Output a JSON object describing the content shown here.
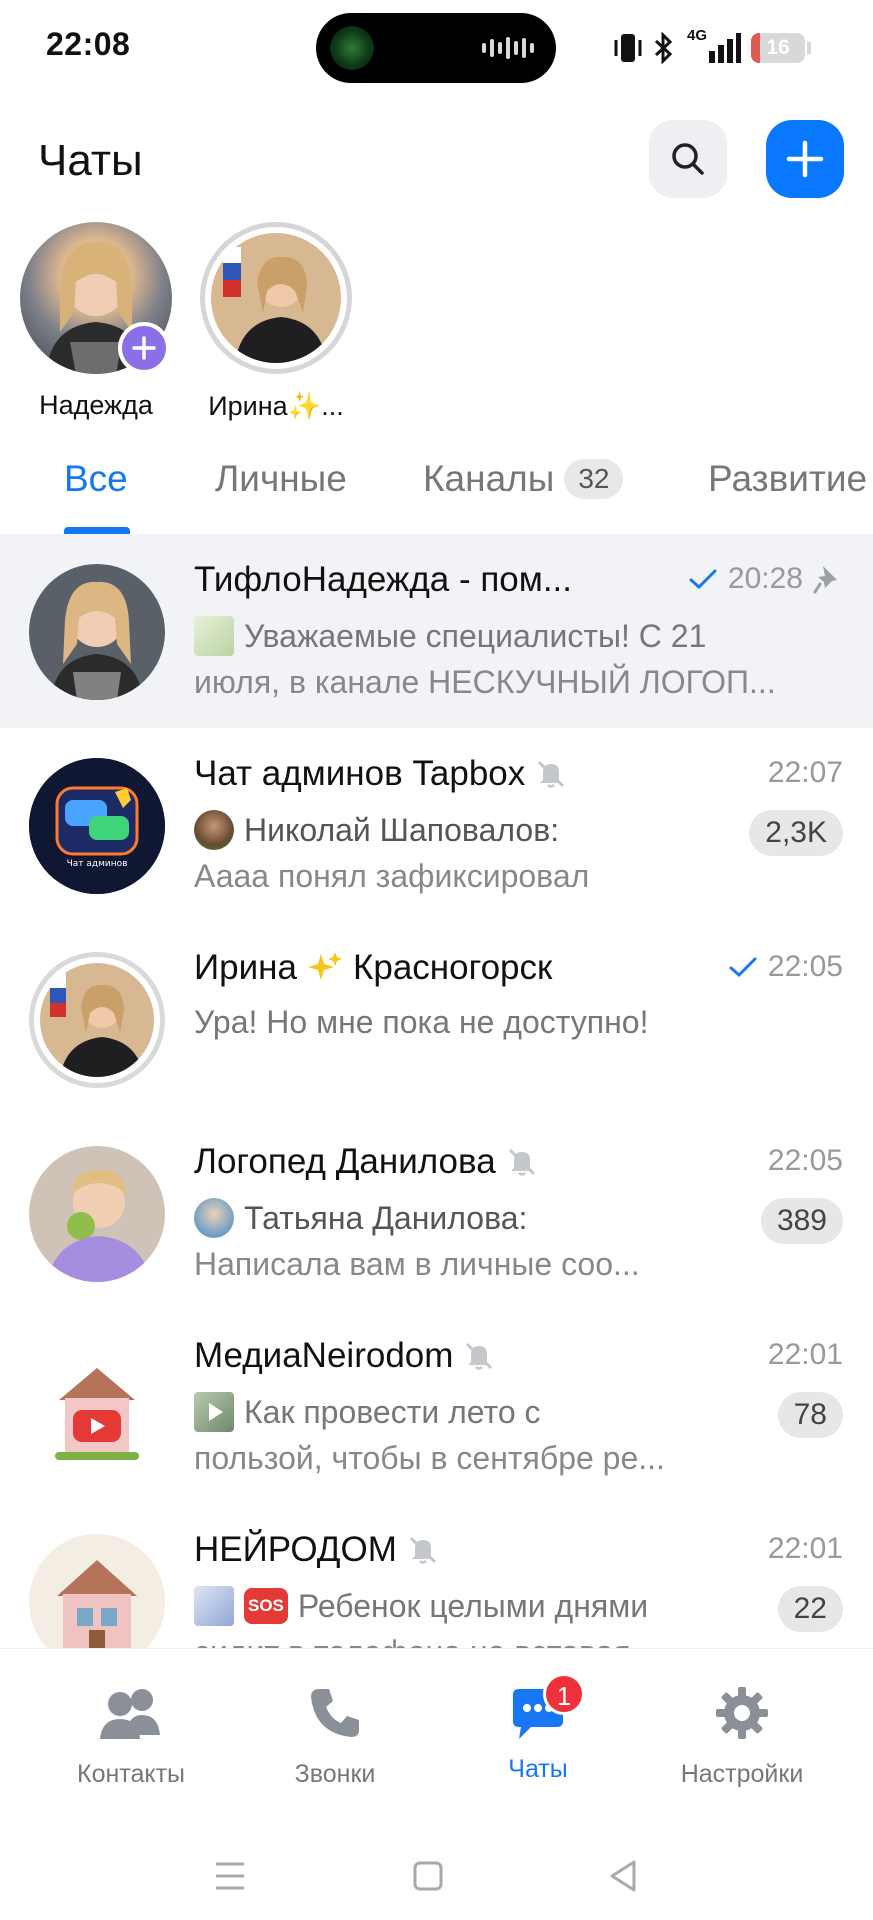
{
  "status_bar": {
    "time": "22:08",
    "network": "4G",
    "battery": "16"
  },
  "header": {
    "title": "Чаты"
  },
  "stories": [
    {
      "name": "Надежда"
    },
    {
      "name": "Ирина✨..."
    }
  ],
  "tabs": [
    {
      "label": "Все"
    },
    {
      "label": "Личные"
    },
    {
      "label": "Каналы",
      "badge": "32"
    },
    {
      "label": "Развитие"
    }
  ],
  "chats": [
    {
      "title": "ТифлоНадежда - пом...",
      "time": "20:28",
      "line1": "Уважаемые специалисты! С 21",
      "line2": "июля, в канале НЕСКУЧНЫЙ ЛОГОП..."
    },
    {
      "title": "Чат админов Tapbox",
      "time": "22:07",
      "line1": "Николай Шаповалов:",
      "line2": "Аааа понял зафиксировал",
      "count": "2,3K",
      "avatar_caption": "Чат админов"
    },
    {
      "title": "Ирина",
      "title_suffix": "Красногорск",
      "time": "22:05",
      "line1": "Ура! Но мне пока не доступно!"
    },
    {
      "title": "Логопед Данилова",
      "time": "22:05",
      "line1": "Татьяна Данилова:",
      "line2": "Написала вам в личные соо...",
      "count": "389"
    },
    {
      "title": "МедиаNeirodom",
      "time": "22:01",
      "line1": "Как провести лето с",
      "line2": "пользой, чтобы в сентябре ре...",
      "count": "78"
    },
    {
      "title": "НЕЙРОДОМ",
      "time": "22:01",
      "line1": "Ребенок целыми днями",
      "line2": "сидит в телефоне не вставая...",
      "count": "22",
      "sos": "SOS"
    }
  ],
  "bottom_nav": [
    {
      "label": "Контакты"
    },
    {
      "label": "Звонки"
    },
    {
      "label": "Чаты",
      "badge": "1"
    },
    {
      "label": "Настройки"
    }
  ],
  "colors": {
    "accent": "#1777f2",
    "badge": "#f0303a",
    "pinned_bg": "#f1f3f7"
  }
}
